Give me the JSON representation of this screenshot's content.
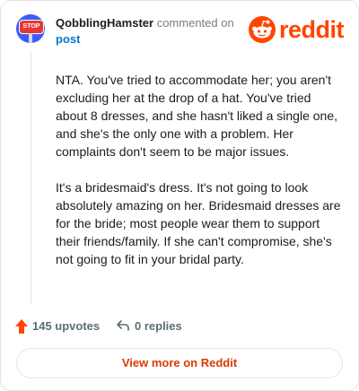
{
  "header": {
    "username": "QobblingHamster",
    "commented": "commented on",
    "post_link": "post",
    "avatar_sign_text": "STOP",
    "brand": "reddit"
  },
  "comment": {
    "paragraphs": [
      "NTA. You've tried to accommodate her; you aren't excluding her at the drop of a hat. You've tried about 8 dresses, and she hasn't liked a single one, and she's the only one with a problem. Her complaints don't seem to be major issues.",
      "It's a bridesmaid's dress. It's not going to look absolutely amazing on her. Bridesmaid dresses are for the bride; most people wear them to support their friends/family. If she can't compromise, she's not going to fit in your bridal party."
    ]
  },
  "actions": {
    "upvotes_label": "145 upvotes",
    "replies_label": "0 replies"
  },
  "footer": {
    "view_more_label": "View more on Reddit"
  },
  "colors": {
    "brand": "#ff4500",
    "link": "#0079d3",
    "view_more": "#d93a00",
    "muted": "#576f76"
  },
  "icons": {
    "avatar": "stop-sign-avatar-icon",
    "logo": "reddit-snoo-icon",
    "upvote": "upvote-arrow-icon",
    "reply": "reply-arrow-icon"
  }
}
